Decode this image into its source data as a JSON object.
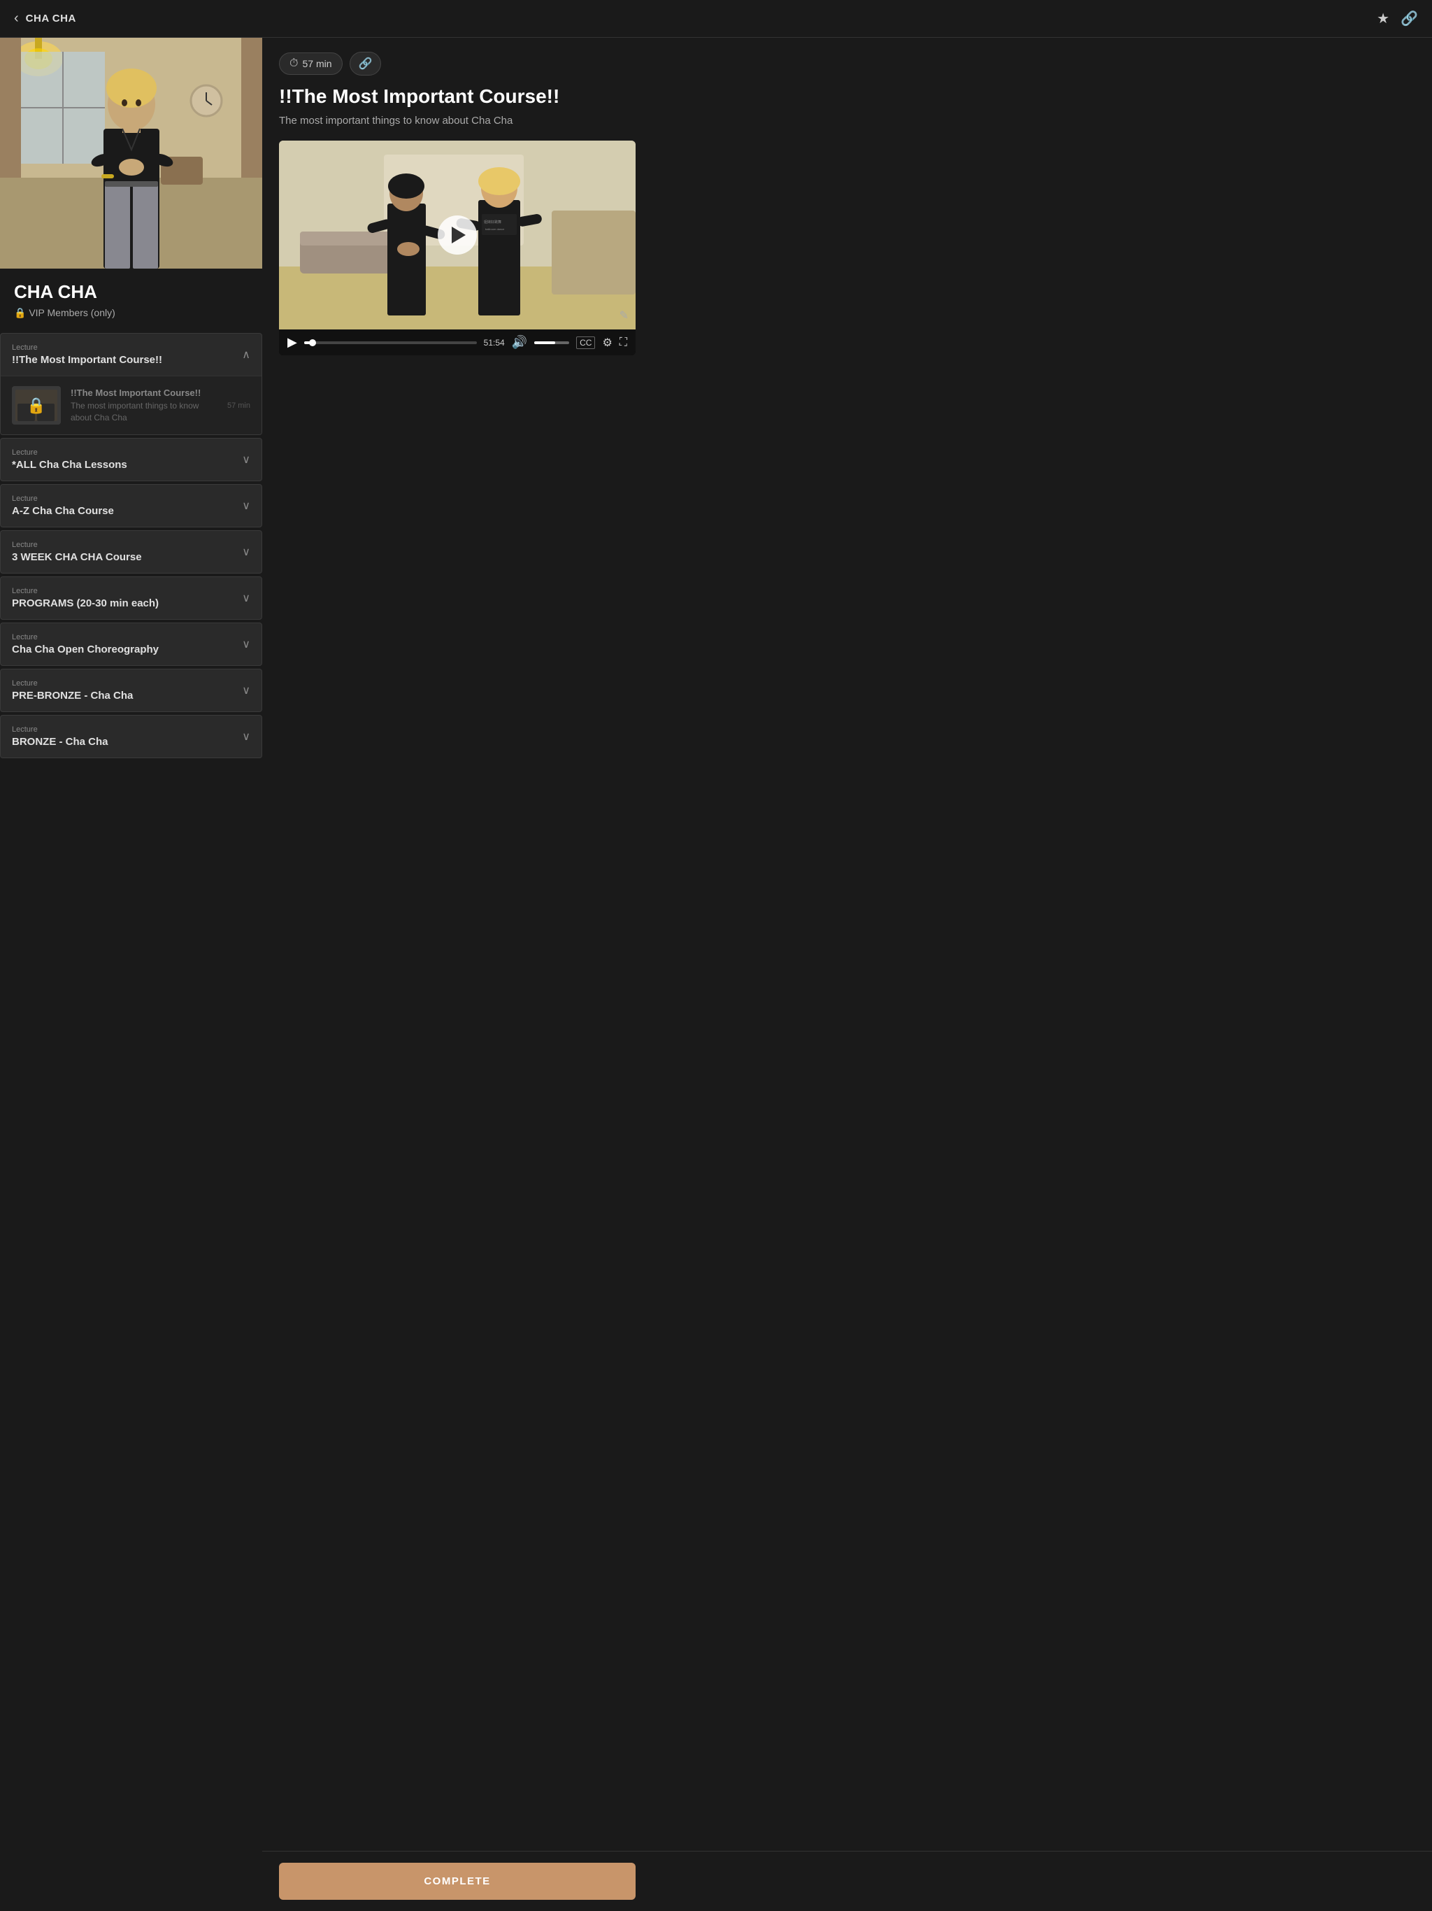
{
  "header": {
    "back_label": "‹",
    "title": "CHA CHA",
    "favorite_icon": "★",
    "share_icon": "🔗"
  },
  "course": {
    "title": "CHA CHA",
    "subtitle": "🔒 VIP Members (only)"
  },
  "content": {
    "duration": "57 min",
    "duration_icon": "⏱",
    "link_icon": "🔗",
    "title": "!!The Most Important Course!!",
    "description": "The most important things to know about Cha Cha",
    "video_time": "51:54",
    "complete_label": "COMPLETE"
  },
  "lectures": [
    {
      "id": 1,
      "label": "Lecture",
      "name": "!!The Most Important Course!!",
      "expanded": true
    },
    {
      "id": 2,
      "label": "Lecture",
      "name": "*ALL Cha Cha Lessons",
      "expanded": false
    },
    {
      "id": 3,
      "label": "Lecture",
      "name": "A-Z Cha Cha Course",
      "expanded": false
    },
    {
      "id": 4,
      "label": "Lecture",
      "name": "3 WEEK CHA CHA Course",
      "expanded": false
    },
    {
      "id": 5,
      "label": "Lecture",
      "name": "PROGRAMS (20-30 min each)",
      "expanded": false
    },
    {
      "id": 6,
      "label": "Lecture",
      "name": "Cha Cha Open Choreography",
      "expanded": false
    },
    {
      "id": 7,
      "label": "Lecture",
      "name": "PRE-BRONZE - Cha Cha",
      "expanded": false
    },
    {
      "id": 8,
      "label": "Lecture",
      "name": "BRONZE - Cha Cha",
      "expanded": false
    }
  ],
  "locked_preview": {
    "title": "!!The Most Important Course!!",
    "description": "The most important things to know about Cha Cha",
    "duration": "57 min",
    "lock_icon": "🔒"
  }
}
